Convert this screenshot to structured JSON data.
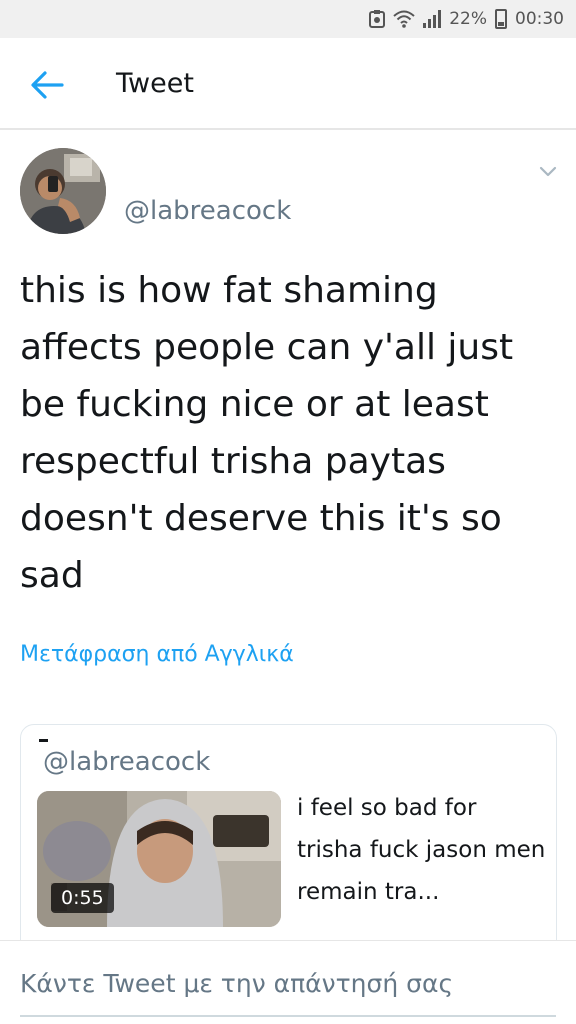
{
  "status_bar": {
    "battery_percent": "22%",
    "time": "00:30",
    "icons": [
      "notification-icon",
      "wifi-icon",
      "signal-icon",
      "battery-icon"
    ]
  },
  "header": {
    "back_icon": "arrow-left-icon",
    "title": "Tweet"
  },
  "tweet": {
    "handle": "@labreacock",
    "text": "this is how fat shaming affects people can y'all just be fucking nice or at least respectful trisha paytas doesn't deserve this it's so sad",
    "translate_link": "Μετάφραση από Αγγλικά"
  },
  "quoted_tweet": {
    "handle": "@labreacock",
    "video_duration": "0:55",
    "text": "i feel so bad for trisha fuck jason men remain tra..."
  },
  "reply": {
    "placeholder": "Κάντε Tweet με την απάντησή σας"
  },
  "colors": {
    "accent": "#1da1f2",
    "secondary_text": "#657786",
    "primary_text": "#14171a"
  }
}
